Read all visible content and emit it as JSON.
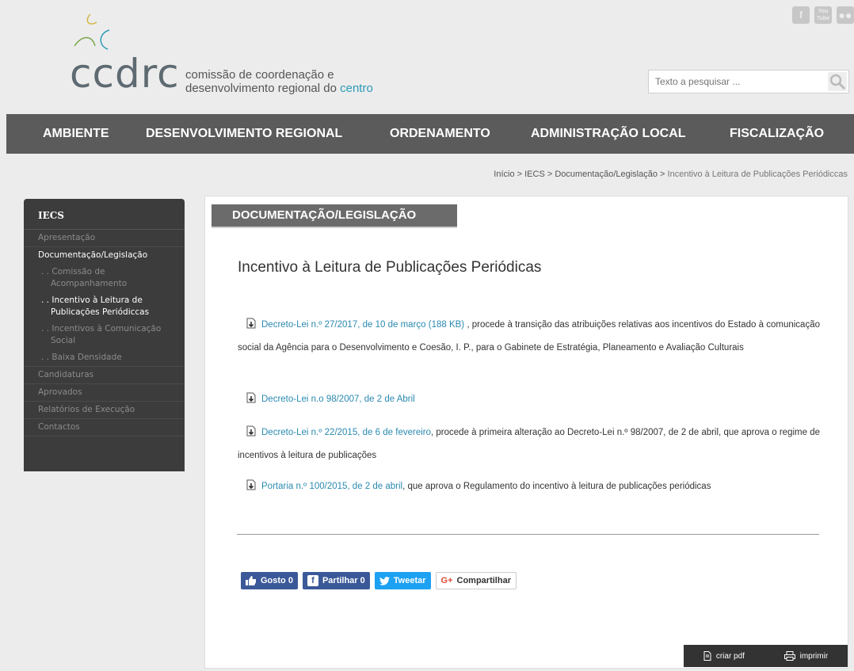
{
  "header": {
    "logo_word": "ccdrc",
    "tagline_line1": "comissão de coordenação e",
    "tagline_line2_prefix": "desenvolvimento regional do ",
    "tagline_line2_highlight": "centro",
    "social": [
      "f",
      "You\nTube",
      "flickr"
    ],
    "search_placeholder": "Texto a pesquisar ..."
  },
  "nav": [
    "AMBIENTE",
    "DESENVOLVIMENTO REGIONAL",
    "ORDENAMENTO",
    "ADMINISTRAÇÃO LOCAL",
    "FISCALIZAÇÃO"
  ],
  "breadcrumb": {
    "items": [
      "Início",
      "IECS",
      "Documentação/Legislação"
    ],
    "current": "Incentivo à Leitura de Publicações Periódiccas",
    "sep": " > "
  },
  "sidebar": {
    "title": "IECS",
    "items": [
      {
        "label": "Apresentação"
      },
      {
        "label": "Documentação/Legislação"
      },
      {
        "label": ". . Comissão de Acompanhamento"
      },
      {
        "label": ". . Incentivo à Leitura de Publicações Periódiccas"
      },
      {
        "label": ". . Incentivos à Comunicação Social"
      },
      {
        "label": ". . Baixa Densidade"
      },
      {
        "label": "Candidaturas"
      },
      {
        "label": "Aprovados"
      },
      {
        "label": "Relatórios de Execução"
      },
      {
        "label": "Contactos"
      }
    ]
  },
  "content": {
    "section_tab": "DOCUMENTAÇÃO/LEGISLAÇÃO",
    "title": "Incentivo à Leitura de Publicações Periódicas",
    "docs": [
      {
        "link": "Decreto-Lei n.º 27/2017, de 10 de março (188 KB)",
        "text": " , procede à transição das atribuições relativas aos incentivos do Estado à comunicação social da Agência para o Desenvolvimento e Coesão, I. P., para o Gabinete de Estratégia, Planeamento e Avaliação Culturais"
      },
      {
        "link": "Decreto-Lei n.o 98/2007, de 2 de Abril",
        "text": ""
      },
      {
        "link": "Decreto-Lei n.º 22/2015, de 6 de fevereiro",
        "text": ", procede à primeira alteração ao Decreto-Lei n.º 98/2007, de 2 de abril, que aprova o regime de incentivos à leitura de publicações"
      },
      {
        "link": "Portaria n.º 100/2015, de 2 de abril",
        "text": ", que aprova o Regulamento do incentivo à leitura de publicações periódicas"
      }
    ]
  },
  "share": {
    "like": "Gosto 0",
    "fb_share": "Partilhar 0",
    "tweet": "Tweetar",
    "gplus_g": "G+",
    "gplus": "Compartilhar"
  },
  "footer": {
    "pdf": "criar pdf",
    "print": "imprimir"
  },
  "colors": {
    "accent": "#2a9ab8",
    "nav": "#5b5b5b",
    "sidebar": "#3c3c3c"
  }
}
